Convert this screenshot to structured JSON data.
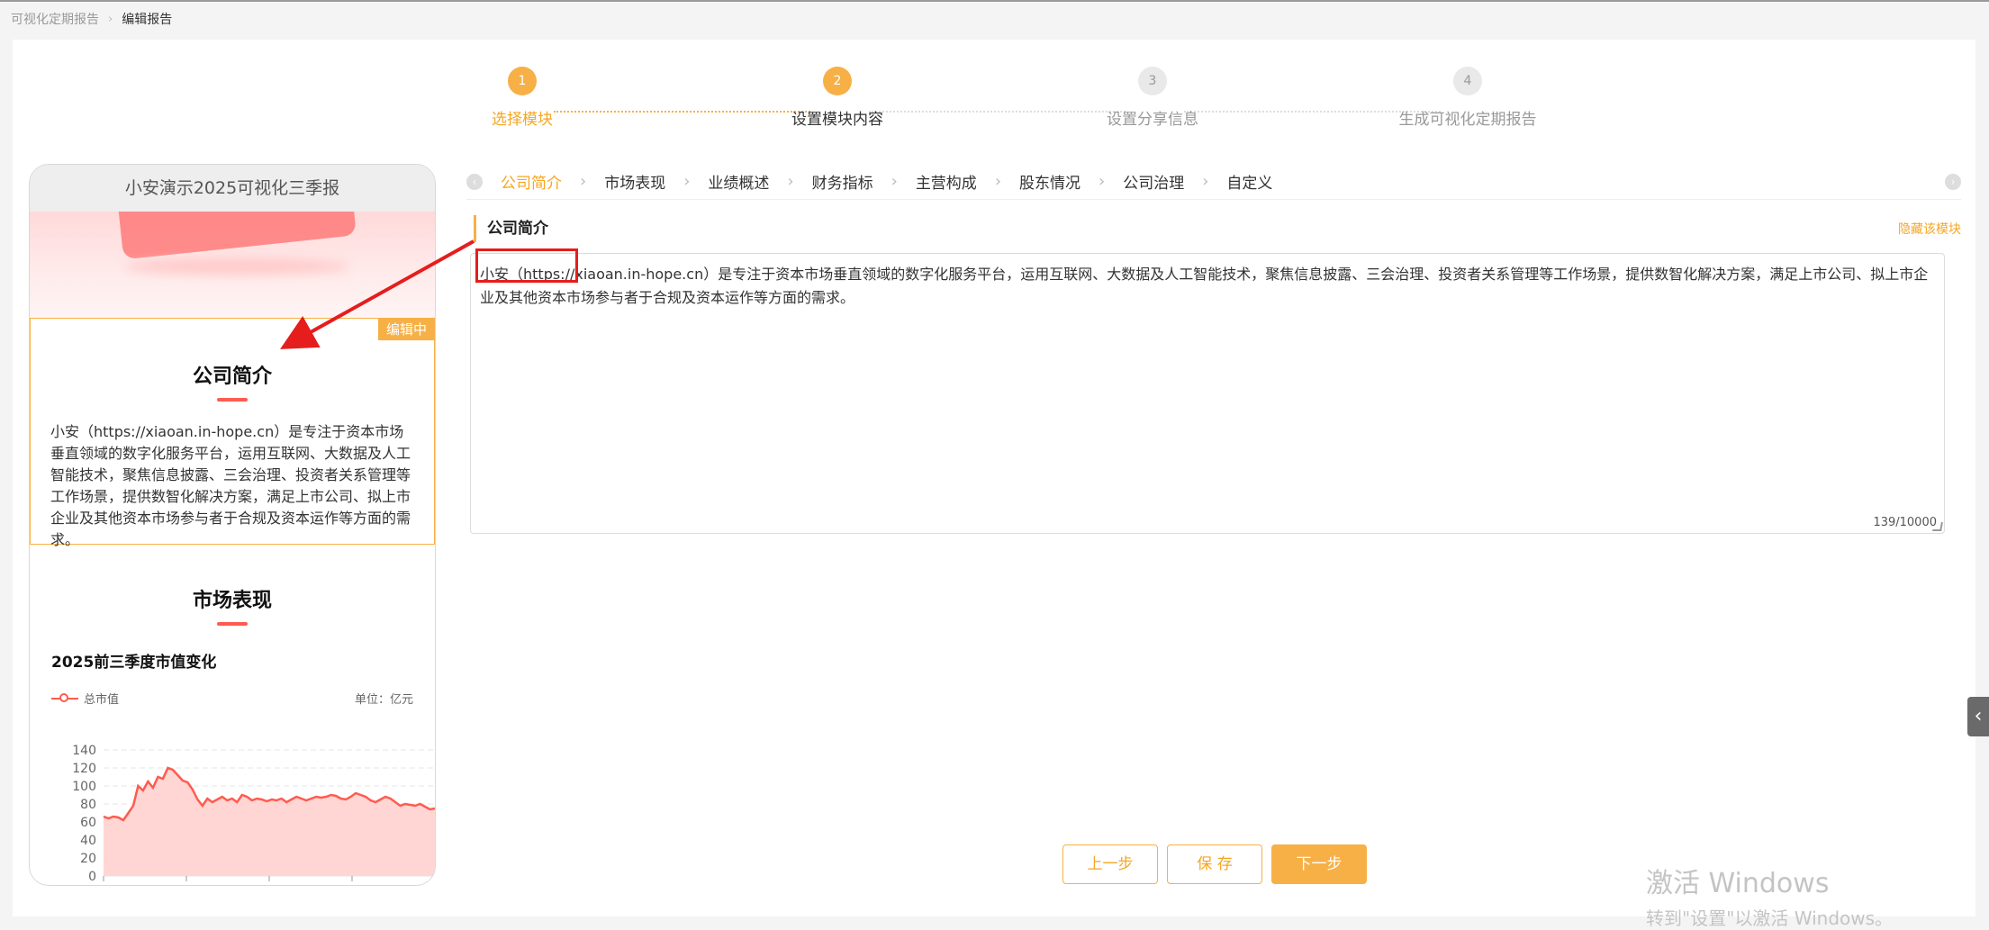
{
  "breadcrumb": {
    "parent": "可视化定期报告",
    "current": "编辑报告"
  },
  "steps": [
    {
      "num": "1",
      "label": "选择模块",
      "state": "done"
    },
    {
      "num": "2",
      "label": "设置模块内容",
      "state": "active"
    },
    {
      "num": "3",
      "label": "设置分享信息",
      "state": "todo"
    },
    {
      "num": "4",
      "label": "生成可视化定期报告",
      "state": "todo"
    }
  ],
  "preview": {
    "title": "小安演示2025可视化三季报",
    "editing_badge": "编辑中",
    "intro": {
      "heading": "公司简介",
      "text": "小安（https://xiaoan.in-hope.cn）是专注于资本市场垂直领域的数字化服务平台，运用互联网、大数据及人工智能技术，聚焦信息披露、三会治理、投资者关系管理等工作场景，提供数智化解决方案，满足上市公司、拟上市企业及其他资本市场参与者于合规及资本运作等方面的需求。"
    },
    "market": {
      "heading": "市场表现"
    }
  },
  "chart_data": {
    "type": "area",
    "title": "2025前三季度市值变化",
    "series": [
      {
        "name": "总市值",
        "values": [
          66,
          64,
          66,
          65,
          62,
          70,
          78,
          100,
          95,
          105,
          98,
          110,
          108,
          120,
          118,
          112,
          106,
          104,
          96,
          85,
          78,
          86,
          82,
          85,
          88,
          84,
          86,
          82,
          90,
          88,
          84,
          86,
          85,
          83,
          85,
          84,
          86,
          82,
          85,
          88,
          86,
          84,
          86,
          88,
          87,
          88,
          90,
          89,
          86,
          85,
          88,
          92,
          90,
          88,
          84,
          82,
          85,
          88,
          86,
          82,
          78,
          80,
          79,
          78,
          80,
          77,
          74,
          75
        ]
      }
    ],
    "unit": "单位：亿元",
    "ylim": [
      0,
      140
    ],
    "yticks": [
      0,
      20,
      40,
      60,
      80,
      100,
      120,
      140
    ],
    "grid": true,
    "legend": "top-left",
    "color": "#ff5b4f"
  },
  "tabs": {
    "items": [
      "公司简介",
      "市场表现",
      "业绩概述",
      "财务指标",
      "主营构成",
      "股东情况",
      "公司治理",
      "自定义"
    ],
    "active": 0,
    "prev_icon": "chevron-left-icon",
    "next_icon": "chevron-right-icon"
  },
  "module": {
    "title": "公司简介",
    "hide_label": "隐藏该模块",
    "text": "小安（https://xiaoan.in-hope.cn）是专注于资本市场垂直领域的数字化服务平台，运用互联网、大数据及人工智能技术，聚焦信息披露、三会治理、投资者关系管理等工作场景，提供数智化解决方案，满足上市公司、拟上市企业及其他资本市场参与者于合规及资本运作等方面的需求。",
    "counter": "139/10000"
  },
  "buttons": {
    "prev": "上一步",
    "save": "保 存",
    "next": "下一步"
  },
  "watermark": {
    "line1": "激活 Windows",
    "line2": "转到\"设置\"以激活 Windows。"
  },
  "colors": {
    "accent": "#f7b046",
    "accent_text": "#f5a623",
    "red": "#e51d1d",
    "series": "#ff5b4f"
  }
}
